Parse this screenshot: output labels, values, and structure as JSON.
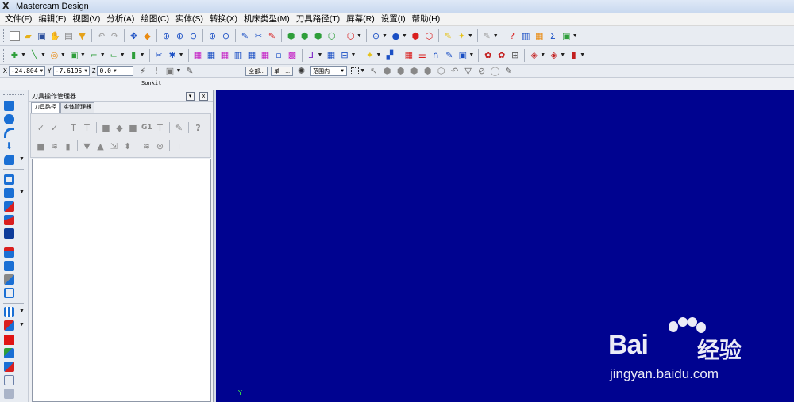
{
  "window": {
    "title": "Mastercam Design",
    "logo_icon": "mastercam-x-logo-icon"
  },
  "menu": [
    "文件(F)",
    "编辑(E)",
    "视图(V)",
    "分析(A)",
    "绘图(C)",
    "实体(S)",
    "转换(X)",
    "机床类型(M)",
    "刀具路径(T)",
    "屏幕(R)",
    "设置(I)",
    "帮助(H)"
  ],
  "coords": {
    "x_value": "-24.804",
    "y_value": "-7.6195",
    "z_value": "0.0",
    "btn_all": "全部...",
    "btn_single": "单一...",
    "select_mode": "范围内"
  },
  "sonkit_label": "Sonkit",
  "ops_manager": {
    "title": "刀具操作管理器",
    "tabs": [
      "刀具路径",
      "实体管理器"
    ],
    "close_glyph": "x",
    "menu_glyph": "▾"
  },
  "viewport": {
    "axis_label": "Y",
    "background": "#000390"
  },
  "watermark": {
    "brand": "Bai",
    "brand_cn": "经验",
    "url": "jingyan.baidu.com"
  },
  "colors": {
    "blue": "#1a4fc4",
    "green": "#2e9e3a",
    "red": "#d91f1f",
    "orange": "#e98b12",
    "yellow": "#e5c21a"
  }
}
